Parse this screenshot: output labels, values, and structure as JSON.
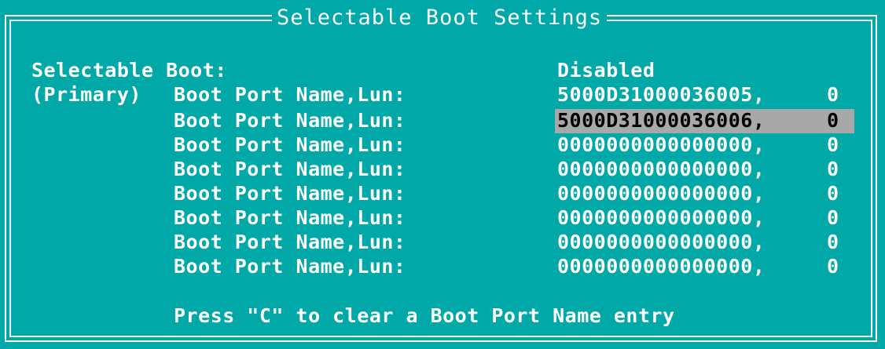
{
  "window": {
    "title": "Selectable Boot Settings"
  },
  "selectable_boot": {
    "label": "Selectable Boot:",
    "value": "Disabled"
  },
  "boot_ports": [
    {
      "prefix": "(Primary)",
      "label": "Boot Port Name,Lun:",
      "wwn": "5000D31000036005,",
      "lun": "0",
      "selected": false
    },
    {
      "prefix": "",
      "label": "Boot Port Name,Lun:",
      "wwn": "5000D31000036006,",
      "lun": "0",
      "selected": true
    },
    {
      "prefix": "",
      "label": "Boot Port Name,Lun:",
      "wwn": "0000000000000000,",
      "lun": "0",
      "selected": false
    },
    {
      "prefix": "",
      "label": "Boot Port Name,Lun:",
      "wwn": "0000000000000000,",
      "lun": "0",
      "selected": false
    },
    {
      "prefix": "",
      "label": "Boot Port Name,Lun:",
      "wwn": "0000000000000000,",
      "lun": "0",
      "selected": false
    },
    {
      "prefix": "",
      "label": "Boot Port Name,Lun:",
      "wwn": "0000000000000000,",
      "lun": "0",
      "selected": false
    },
    {
      "prefix": "",
      "label": "Boot Port Name,Lun:",
      "wwn": "0000000000000000,",
      "lun": "0",
      "selected": false
    },
    {
      "prefix": "",
      "label": "Boot Port Name,Lun:",
      "wwn": "0000000000000000,",
      "lun": "0",
      "selected": false
    }
  ],
  "footer": {
    "hint": "Press \"C\" to clear a Boot Port Name entry"
  },
  "colors": {
    "background": "#00a8a8",
    "text": "#ffffff",
    "highlight_bg": "#a8a8a8",
    "highlight_text": "#000000"
  }
}
